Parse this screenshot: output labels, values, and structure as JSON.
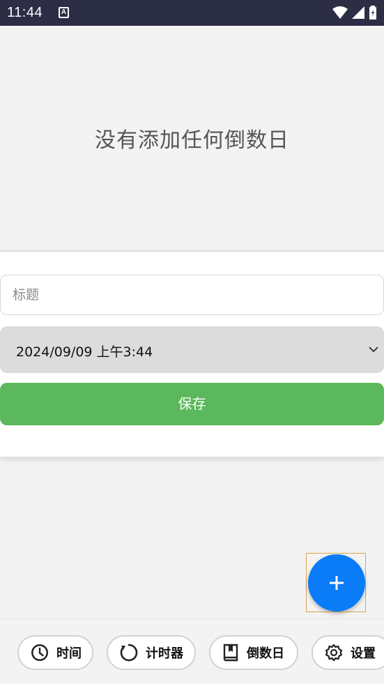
{
  "status_bar": {
    "time": "11:44",
    "notification_glyph": "A"
  },
  "empty_state": {
    "message": "没有添加任何倒数日"
  },
  "form": {
    "title_placeholder": "标题",
    "title_value": "",
    "date_value": "2024/09/09 上午3:44",
    "save_label": "保存"
  },
  "fab": {
    "icon": "plus-icon",
    "color": "#0a7cf7"
  },
  "bottom_nav": {
    "items": [
      {
        "label": "时间",
        "icon": "clock-icon"
      },
      {
        "label": "计时器",
        "icon": "timer-icon"
      },
      {
        "label": "倒数日",
        "icon": "book-icon"
      },
      {
        "label": "设置",
        "icon": "gear-icon"
      }
    ]
  },
  "colors": {
    "status_bar": "#2b2e45",
    "save_button": "#5cb85c",
    "fab": "#0a7cf7",
    "background": "#f3f3f3"
  }
}
